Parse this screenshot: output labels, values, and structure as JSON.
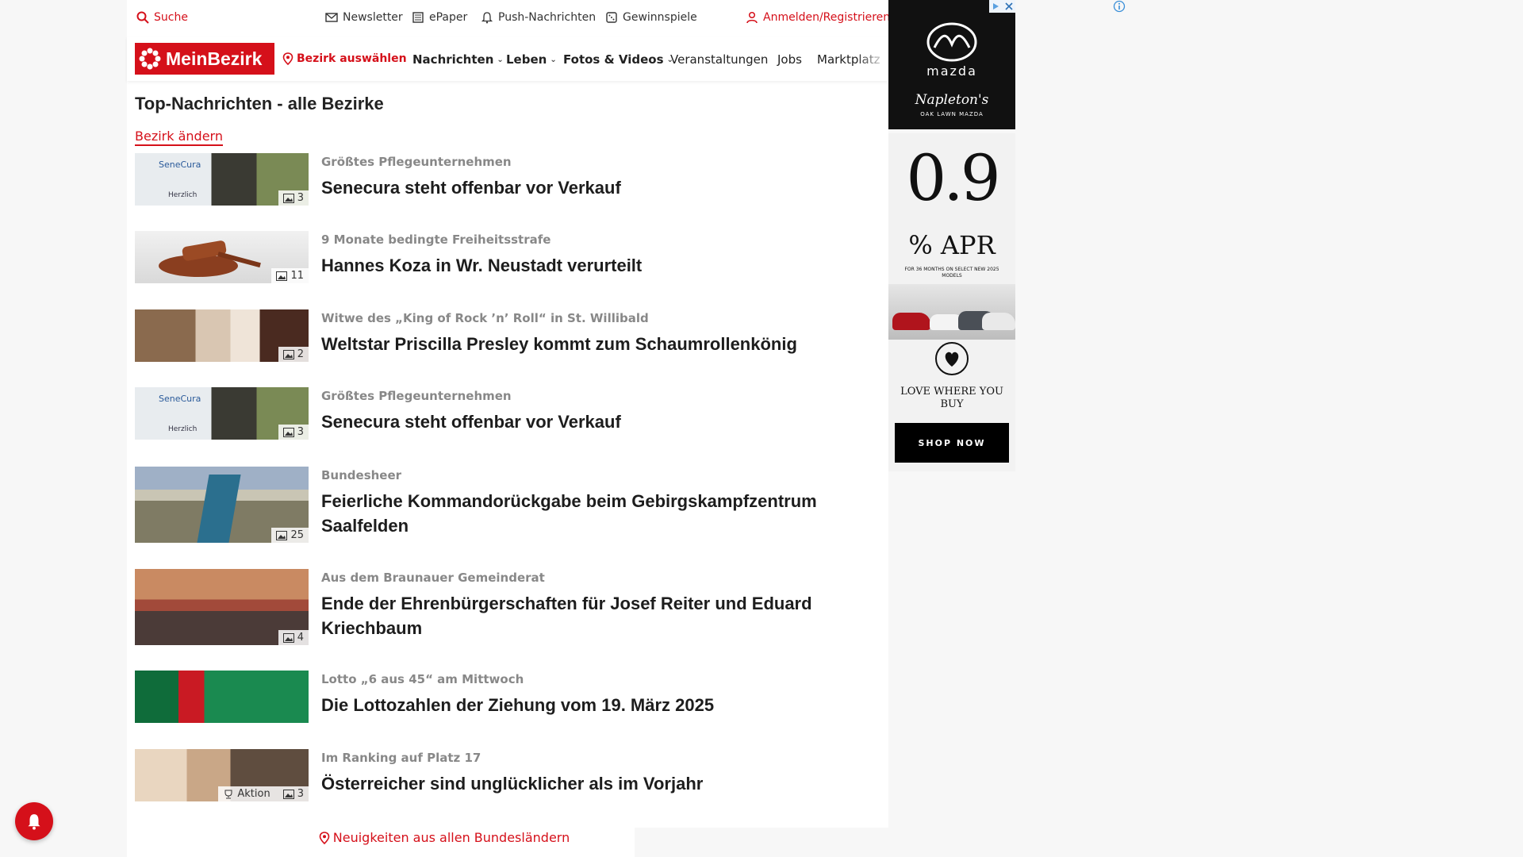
{
  "topbar": {
    "search": "Suche",
    "newsletter": "Newsletter",
    "epaper": "ePaper",
    "push": "Push-Nachrichten",
    "games": "Gewinnspiele",
    "login": "Anmelden/Registrieren"
  },
  "nav": {
    "logo": "MeinBezirk",
    "select_district": "Bezirk auswählen",
    "items": [
      "Nachrichten",
      "Leben",
      "Fotos & Videos",
      "Veranstaltungen",
      "Jobs",
      "Marktplatz"
    ]
  },
  "main": {
    "title": "Top-Nachrichten - alle Bezirke",
    "change_district": "Bezirk ändern",
    "articles": [
      {
        "kicker": "Größtes Pflegeunternehmen",
        "headline": "Senecura steht offenbar vor Verkauf",
        "photos": "3"
      },
      {
        "kicker": "9 Monate bedingte Freiheitsstrafe",
        "headline": "Hannes Koza in Wr. Neustadt verurteilt",
        "photos": "11"
      },
      {
        "kicker": "Witwe des „King of Rock ’n’ Roll“ in St. Willibald",
        "headline": "Weltstar Priscilla Presley kommt zum Schaumrollenkönig",
        "photos": "2"
      },
      {
        "kicker": "Größtes Pflegeunternehmen",
        "headline": "Senecura steht offenbar vor Verkauf",
        "photos": "3"
      },
      {
        "kicker": "Bundesheer",
        "headline": "Feierliche Kommandorückgabe beim Gebirgskampfzentrum Saalfelden",
        "photos": "25"
      },
      {
        "kicker": "Aus dem Braunauer Gemeinderat",
        "headline": "Ende der Ehrenbürgerschaften für Josef Reiter und Eduard Kriechbaum",
        "photos": "4"
      },
      {
        "kicker": "Lotto „6 aus 45“ am Mittwoch",
        "headline": "Die Lottozahlen der Ziehung vom 19. März 2025",
        "photos": ""
      },
      {
        "kicker": "Im Ranking auf Platz 17",
        "headline": "Österreicher sind unglücklicher als im Vorjahr",
        "photos": "3",
        "action": "Aktion"
      }
    ],
    "thumb_texts": {
      "senecura": "SeneCura",
      "welcome": "Herzlich"
    },
    "regions_link": "Neuigkeiten aus allen Bundesländern"
  },
  "ads": {
    "mazda": {
      "brand": "mazda",
      "dealer": "Napleton's",
      "dealer_sub": "OAK LAWN MAZDA"
    },
    "apr": {
      "rate": "0.9",
      "unit": "% APR",
      "terms": "FOR 36 MONTHS ON SELECT NEW 2025 MODELS",
      "tagline": "LOVE WHERE YOU BUY",
      "cta": "SHOP NOW"
    }
  },
  "colors": {
    "brand_red": "#d5101a"
  }
}
